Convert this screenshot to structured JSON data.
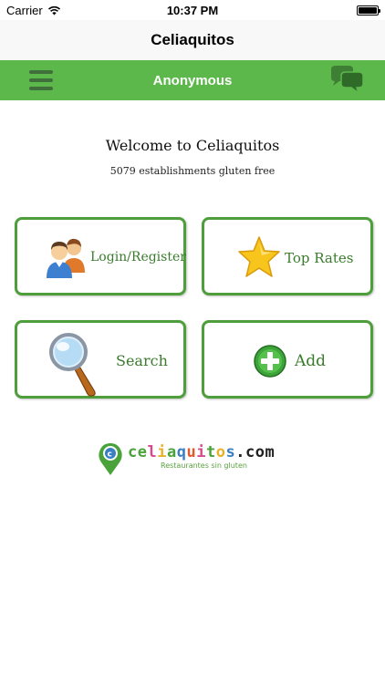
{
  "status_bar": {
    "carrier": "Carrier",
    "time": "10:37 PM",
    "battery_level": 1.0
  },
  "nav": {
    "title": "Celiaquitos"
  },
  "header": {
    "title": "Anonymous",
    "menu_icon": "hamburger-icon",
    "chat_icon": "chat-bubbles-icon"
  },
  "welcome": {
    "title": "Welcome to Celiaquitos",
    "subtitle": "5079 establishments gluten free"
  },
  "tiles": [
    {
      "label": "Login/Register",
      "icon": "users-icon"
    },
    {
      "label": "Top Rates",
      "icon": "star-icon"
    },
    {
      "label": "Search",
      "icon": "magnifier-icon"
    },
    {
      "label": "Add",
      "icon": "add-plus-icon"
    }
  ],
  "logo": {
    "letters": [
      "c",
      "e",
      "l",
      "i",
      "a",
      "q",
      "u",
      "i",
      "t",
      "o",
      "s",
      ".",
      "c",
      "o",
      "m"
    ],
    "letter_colors": [
      "#4aa33a",
      "#4aa33a",
      "#d94a8c",
      "#e8b128",
      "#4aa33a",
      "#3a7fc4",
      "#e2572b",
      "#d94a8c",
      "#4aa33a",
      "#e8b128",
      "#3a7fc4",
      "#222222",
      "#222222",
      "#222222",
      "#222222"
    ],
    "tagline": "Restaurantes sin gluten"
  },
  "colors": {
    "header_green": "#5cb84a",
    "tile_border": "#4f9e3c",
    "tile_text": "#3a7b2d"
  }
}
